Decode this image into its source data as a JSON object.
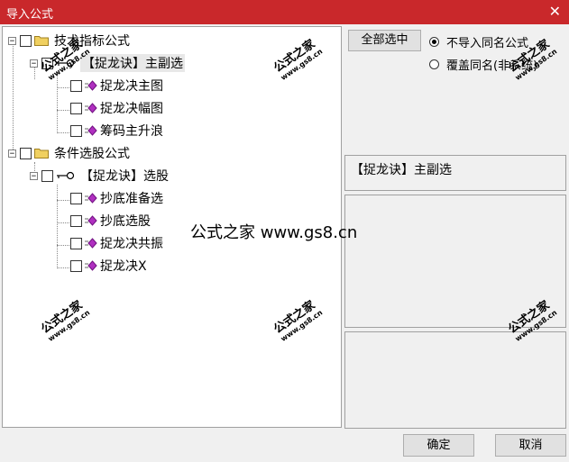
{
  "window": {
    "title": "导入公式",
    "close_glyph": "✕"
  },
  "tree": {
    "groups": [
      {
        "label": "技术指标公式",
        "expander": "−",
        "children": [
          {
            "label": "【捉龙诀】主副选",
            "expander": "−",
            "children": [
              {
                "label": "捉龙决主图"
              },
              {
                "label": "捉龙决幅图"
              },
              {
                "label": "筹码主升浪"
              }
            ]
          }
        ]
      },
      {
        "label": "条件选股公式",
        "expander": "−",
        "children": [
          {
            "label": "【捉龙诀】选股",
            "expander": "−",
            "children": [
              {
                "label": "抄底准备选"
              },
              {
                "label": "抄底选股"
              },
              {
                "label": "捉龙决共振"
              },
              {
                "label": "捉龙决X"
              }
            ]
          }
        ]
      }
    ]
  },
  "options": {
    "select_all_label": "全部选中",
    "radio_skip_label": "不导入同名公式",
    "radio_overwrite_label": "覆盖同名(非系统)",
    "selected_radio": "skip"
  },
  "selected_name": "【捉龙诀】主副选",
  "buttons": {
    "ok": "确定",
    "cancel": "取消"
  },
  "watermark": {
    "cn": "公式之家",
    "url": "www.gs8.cn",
    "center_text": "公式之家 www.gs8.cn"
  },
  "colors": {
    "titlebar": "#c9282b",
    "diamond": "#b030c0",
    "folder": "#f0d060"
  }
}
